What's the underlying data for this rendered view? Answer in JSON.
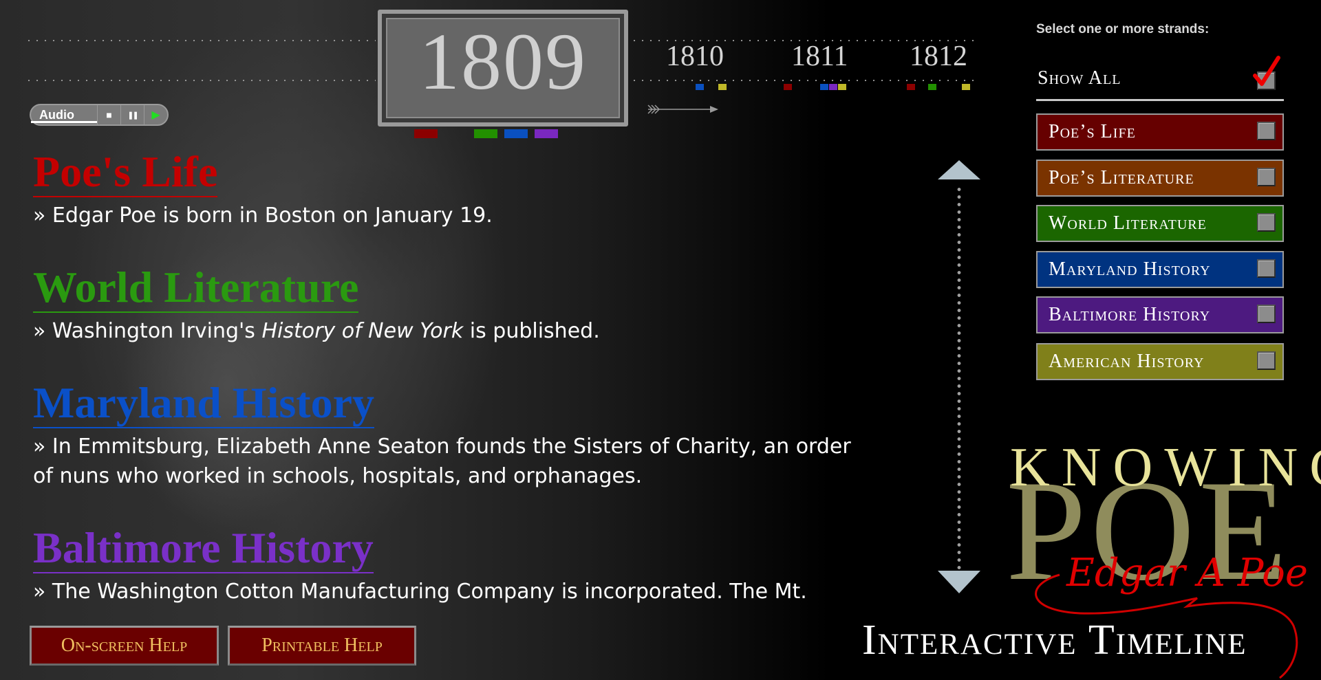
{
  "timeline": {
    "current_year": "1809",
    "current_year_markers": [
      {
        "strand": "poes-life",
        "color": "#8c0000"
      },
      {
        "strand": "world-literature",
        "color": "#229000"
      },
      {
        "strand": "maryland-history",
        "color": "#0a50c0"
      },
      {
        "strand": "baltimore-history",
        "color": "#7a28c0"
      }
    ],
    "upcoming_years": [
      {
        "year": "1810",
        "markers": [
          "#0a50c0",
          "#c0b828"
        ]
      },
      {
        "year": "1811",
        "markers": [
          "#8c0000",
          "#0a50c0",
          "#7a28c0",
          "#c0b828"
        ]
      },
      {
        "year": "1812",
        "markers": [
          "#8c0000",
          "#229000",
          "#c0b828"
        ]
      }
    ],
    "forward_arrow_icon": "arrow-right-icon"
  },
  "audio": {
    "label": "Audio",
    "stop_glyph": "■",
    "pause_glyph": "❚❚",
    "play_glyph": "▶"
  },
  "entries": [
    {
      "heading": "Poe's Life",
      "color": "#c40000",
      "text": "» Edgar Poe is born in Boston on January 19."
    },
    {
      "heading": "World Literature",
      "color": "#2a9a10",
      "text_before": "» Washington Irving's ",
      "text_italic": "History of New York",
      "text_after": " is published."
    },
    {
      "heading": "Maryland History",
      "color": "#0a50c8",
      "text_line1": "» In Emmitsburg, Elizabeth Anne Seaton founds the Sisters of Charity, an order",
      "text_line2": "of nuns who worked in schools, hospitals, and orphanages."
    },
    {
      "heading": "Baltimore History",
      "color": "#7a30c8",
      "text": "» The Washington Cotton Manufacturing Company is incorporated.  The Mt."
    }
  ],
  "strands": {
    "title": "Select one or more strands:",
    "show_all": {
      "label": "Show All",
      "checked": true
    },
    "items": [
      {
        "label": "Poe’s Life",
        "color": "#660000",
        "checked": false
      },
      {
        "label": "Poe’s Literature",
        "color": "#7a3300",
        "checked": false
      },
      {
        "label": "World Literature",
        "color": "#1b6600",
        "checked": false
      },
      {
        "label": "Maryland History",
        "color": "#003380",
        "checked": false
      },
      {
        "label": "Baltimore History",
        "color": "#4d1a80",
        "checked": false
      },
      {
        "label": "American History",
        "color": "#80801a",
        "checked": false
      }
    ]
  },
  "help": {
    "onscreen": "On-screen Help",
    "printable": "Printable Help"
  },
  "logo": {
    "knowing": "KNOWING",
    "poe": "POE",
    "signature": "Edgar A Poe",
    "subtitle": "Interactive Timeline"
  }
}
